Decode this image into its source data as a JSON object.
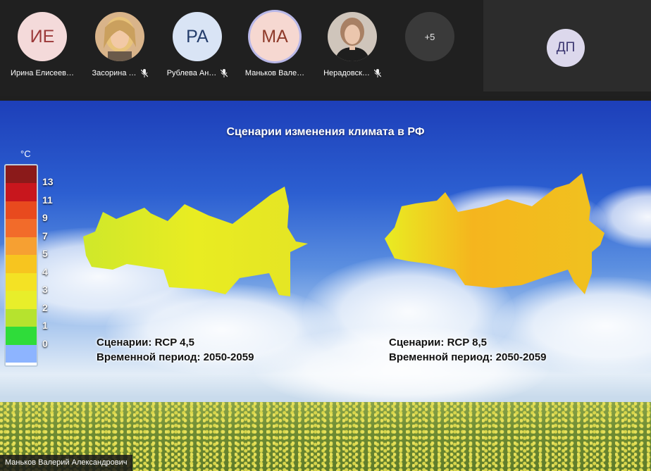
{
  "participants": [
    {
      "initials": "ИЕ",
      "name": "Ирина Елисеев…",
      "muted": false,
      "bg": "#f4dada",
      "fg": "#9b3838",
      "photo": false
    },
    {
      "initials": "",
      "name": "Засорина …",
      "muted": true,
      "photo": true,
      "photo_kind": "blonde"
    },
    {
      "initials": "РА",
      "name": "Рублева Ан…",
      "muted": true,
      "bg": "#d9e4f5",
      "fg": "#243d6b",
      "photo": false
    },
    {
      "initials": "МА",
      "name": "Маньков Вале…",
      "muted": false,
      "bg": "#f6d8d1",
      "fg": "#8e3a2a",
      "photo": false,
      "active": true
    },
    {
      "initials": "",
      "name": "Нерадовск…",
      "muted": true,
      "photo": true,
      "photo_kind": "woman"
    }
  ],
  "more": "+5",
  "self": {
    "initials": "ДП"
  },
  "slide": {
    "title": "Сценарии изменения климата в РФ",
    "legend": {
      "unit": "°C",
      "colors": [
        "#8b1a1a",
        "#c8161d",
        "#e84a1e",
        "#f26b2a",
        "#f6a032",
        "#f7c51f",
        "#f4e224",
        "#e8ee2a",
        "#b6e32e",
        "#2fdc3a",
        "#8db4ff"
      ],
      "labels": [
        "13",
        "11",
        "9",
        "7",
        "5",
        "4",
        "3",
        "2",
        "1",
        "0"
      ]
    },
    "left": {
      "line1": "Сценарии: RCP 4,5",
      "line2": "Временной период: 2050-2059"
    },
    "right": {
      "line1": "Сценарии: RCP 8,5",
      "line2": "Временной период: 2050-2059"
    }
  },
  "speaker_name": "Маньков Валерий Александрович",
  "icons": {
    "mic": "mic-off-icon"
  }
}
